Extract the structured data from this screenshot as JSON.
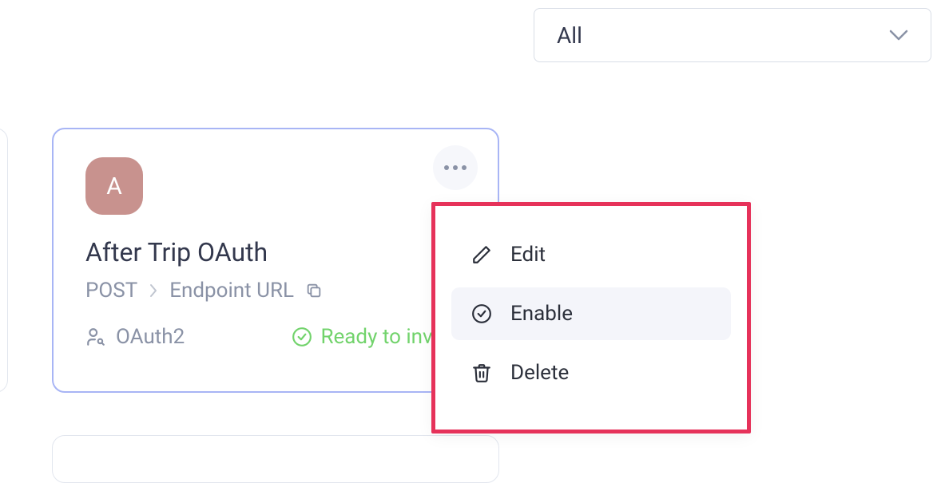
{
  "filter": {
    "selected": "All"
  },
  "card": {
    "avatar_letter": "A",
    "title": "After Trip OAuth",
    "method": "POST",
    "endpoint_label": "Endpoint URL",
    "auth_type": "OAuth2",
    "status": "Ready to invoke"
  },
  "menu": {
    "edit": "Edit",
    "enable": "Enable",
    "delete": "Delete"
  }
}
